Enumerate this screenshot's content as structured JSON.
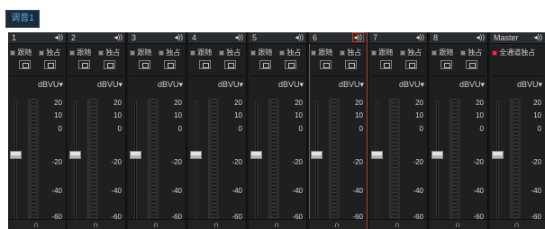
{
  "tab": {
    "label": "调音1"
  },
  "strips": [
    {
      "name": "1",
      "follow": "跟随",
      "solo": "独占",
      "unit": "dBVU"
    },
    {
      "name": "2",
      "follow": "跟随",
      "solo": "独占",
      "unit": "dBVU"
    },
    {
      "name": "3",
      "follow": "跟随",
      "solo": "独占",
      "unit": "dBVU"
    },
    {
      "name": "4",
      "follow": "跟随",
      "solo": "独占",
      "unit": "dBVU"
    },
    {
      "name": "5",
      "follow": "跟随",
      "solo": "独占",
      "unit": "dBVU"
    },
    {
      "name": "6",
      "follow": "跟随",
      "solo": "独占",
      "unit": "dBVU"
    },
    {
      "name": "7",
      "follow": "跟随",
      "solo": "独占",
      "unit": "dBVU"
    },
    {
      "name": "8",
      "follow": "跟随",
      "solo": "独占",
      "unit": "dBVU"
    }
  ],
  "master": {
    "name": "Master",
    "solo_all": "全通道独占",
    "unit": "dBVU"
  },
  "scale_labels": [
    "20",
    "10",
    "0",
    "-20",
    "-40",
    "-60"
  ],
  "speaker_glyph": "◂))",
  "headphone_glyph": "∩",
  "dropdown_glyph": "▾",
  "colors": {
    "accent": "#4db8ff",
    "selection": "#c0392b",
    "solo_active": "#d8384a"
  }
}
